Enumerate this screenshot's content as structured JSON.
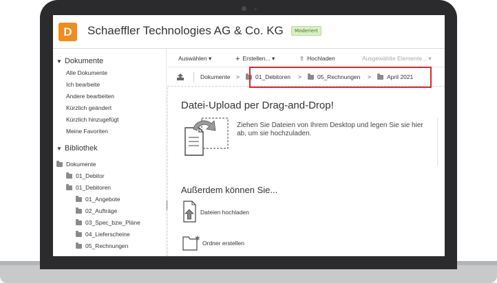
{
  "header": {
    "logo_letter": "D",
    "site_title": "Schaeffler Technologies AG & Co. KG",
    "badge": "Moderiert",
    "accent": "#f28c1a"
  },
  "sidebar": {
    "documents_title": "Dokumente",
    "document_links": [
      "Alle Dokumente",
      "Ich bearbeite",
      "Andere bearbeiten",
      "Kürzlich geändert",
      "Kürzlich hinzugefügt",
      "Meine Favoriten"
    ],
    "library_title": "Bibliothek",
    "tree": [
      "Dokumente",
      "01_Debitor",
      "01_Debitoren",
      "01_Angebote",
      "02_Aufträge",
      "03_Spec_bzw_Pläne",
      "04_Lieferscheine",
      "05_Rechnungen"
    ]
  },
  "toolbar": {
    "select_label": "Auswählen ▾",
    "create_label": "Erstellen... ▾",
    "upload_label": "Hochladen",
    "selected_items_label": "Ausgewählte Elemente... ▾"
  },
  "breadcrumb": {
    "root": "Dokumente",
    "items": [
      "01_Debitoren",
      "05_Rechnungen",
      "April 2021"
    ],
    "separator": ">",
    "highlight_color": "#e0262b"
  },
  "content": {
    "upload_title": "Datei-Upload per Drag-and-Drop!",
    "upload_text": "Ziehen Sie Dateien von Ihrem Desktop und legen Sie sie hier ab, um sie hochzuladen.",
    "also_title": "Außerdem können Sie...",
    "upload_files_label": "Dateien hochladen",
    "create_folder_label": "Ordner erstellen"
  }
}
